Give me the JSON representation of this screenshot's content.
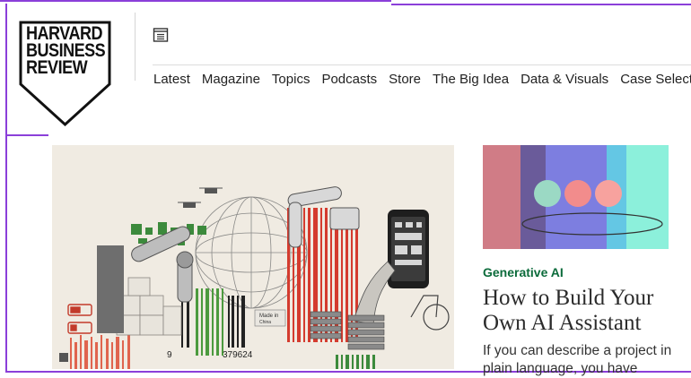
{
  "site": {
    "logo_lines": [
      "HARVARD",
      "BUSINESS",
      "REVIEW"
    ]
  },
  "header": {
    "menu_icon": "menu-list-icon",
    "nav": [
      {
        "label": "Latest"
      },
      {
        "label": "Magazine"
      },
      {
        "label": "Topics"
      },
      {
        "label": "Podcasts"
      },
      {
        "label": "Store"
      },
      {
        "label": "The Big Idea"
      },
      {
        "label": "Data & Visuals"
      },
      {
        "label": "Case Selections"
      }
    ]
  },
  "hero": {
    "barcode_number": "379624",
    "barcode_prefix": "9",
    "made_in_label": "Made in",
    "made_in_sub": "China"
  },
  "article": {
    "topic": "Generative AI",
    "title": "How to Build Your Own AI Assistant",
    "summary": "If you can describe a project in plain language, you have"
  },
  "colors": {
    "frame_accent": "#8b3fd9",
    "topic_green": "#0c6b3b",
    "hero_background": "#f0ebe2"
  }
}
